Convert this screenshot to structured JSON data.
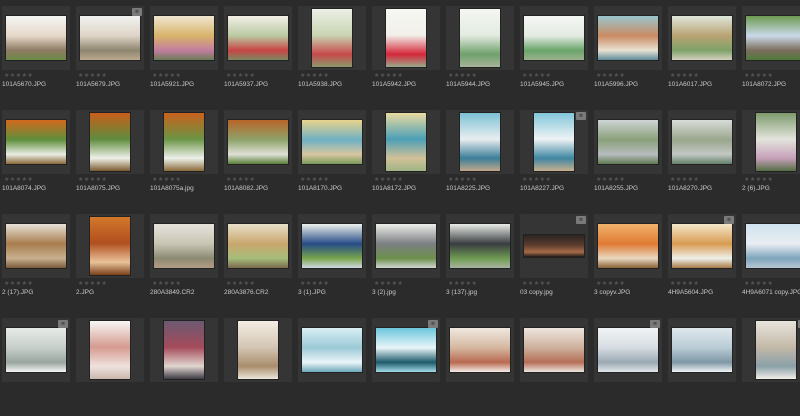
{
  "browser": {
    "star_glyphs": "★★★★★",
    "badge_label": "≡",
    "items": [
      {
        "filename": "101A5670.JPG",
        "orient": "landscape",
        "badge": false,
        "colors": [
          "#f4f6f4",
          "#e7d8c9",
          "#8d7a62",
          "#6b8a45"
        ]
      },
      {
        "filename": "101A5679.JPG",
        "orient": "landscape",
        "badge": true,
        "colors": [
          "#f2f3f1",
          "#ded4c6",
          "#8f8670",
          "#b9a98f"
        ]
      },
      {
        "filename": "101A5921.JPG",
        "orient": "landscape",
        "badge": false,
        "colors": [
          "#efe6d2",
          "#d7b46a",
          "#c47da0",
          "#6b7c57"
        ]
      },
      {
        "filename": "101A5937.JPG",
        "orient": "landscape",
        "badge": false,
        "colors": [
          "#f3efe6",
          "#b9c9a2",
          "#c84545",
          "#7b8a62"
        ]
      },
      {
        "filename": "101A5938.JPG",
        "orient": "portrait",
        "badge": false,
        "colors": [
          "#ecefe6",
          "#c9d6b4",
          "#c74a4a",
          "#8b9a6c"
        ]
      },
      {
        "filename": "101A5942.JPG",
        "orient": "portrait",
        "badge": false,
        "colors": [
          "#f6f7f3",
          "#f2f0ea",
          "#d4273a",
          "#9aa98b"
        ]
      },
      {
        "filename": "101A5944.JPG",
        "orient": "portrait",
        "badge": false,
        "colors": [
          "#f4f6f2",
          "#e4ece2",
          "#6fa06b",
          "#a8b49a"
        ]
      },
      {
        "filename": "101A5945.JPG",
        "orient": "landscape",
        "badge": false,
        "colors": [
          "#f5f7f4",
          "#e3ebe2",
          "#6aa56a",
          "#9ab18d"
        ]
      },
      {
        "filename": "101A5996.JPG",
        "orient": "landscape",
        "badge": false,
        "colors": [
          "#9ac6cf",
          "#c98b62",
          "#e9e2d3",
          "#5d8a9a"
        ]
      },
      {
        "filename": "101A6017.JPG",
        "orient": "landscape",
        "badge": false,
        "colors": [
          "#dfe7dc",
          "#b9a272",
          "#7fa269",
          "#d4d0bd"
        ]
      },
      {
        "filename": "101A8072.JPG",
        "orient": "landscape",
        "badge": false,
        "colors": [
          "#6d9a52",
          "#c9d9e9",
          "#7b6d5c",
          "#4f7b3a"
        ]
      },
      {
        "filename": "101A8074.JPG",
        "orient": "landscape",
        "badge": false,
        "colors": [
          "#d16a1e",
          "#5e8f3c",
          "#e9ede4",
          "#8a6a3a"
        ]
      },
      {
        "filename": "101A8075.JPG",
        "orient": "portrait",
        "badge": false,
        "colors": [
          "#c95e1a",
          "#5f8c3d",
          "#eef0e8",
          "#7b5a2e"
        ]
      },
      {
        "filename": "101A8075a.jpg",
        "orient": "portrait",
        "badge": false,
        "colors": [
          "#c9611c",
          "#6b9444",
          "#edf0ea",
          "#8a6a38"
        ]
      },
      {
        "filename": "101A8082.JPG",
        "orient": "landscape",
        "badge": false,
        "colors": [
          "#b86428",
          "#8ea36a",
          "#dfe0d6",
          "#5a7e3a"
        ]
      },
      {
        "filename": "101A8170.JPG",
        "orient": "landscape",
        "badge": false,
        "colors": [
          "#e8d38d",
          "#6fb0c4",
          "#d7c7a0",
          "#7a9a5a"
        ]
      },
      {
        "filename": "101A8172.JPG",
        "orient": "portrait",
        "badge": false,
        "colors": [
          "#eadba0",
          "#4c9fb6",
          "#d2c198",
          "#9fb486"
        ]
      },
      {
        "filename": "101A8225.JPG",
        "orient": "portrait",
        "badge": false,
        "colors": [
          "#7cc1d4",
          "#e9eef0",
          "#3c7d99",
          "#c2a98a"
        ]
      },
      {
        "filename": "101A8227.JPG",
        "orient": "portrait",
        "badge": true,
        "colors": [
          "#82c6da",
          "#eef3f4",
          "#3f86a2",
          "#c9b08f"
        ]
      },
      {
        "filename": "101A8255.JPG",
        "orient": "landscape",
        "badge": false,
        "colors": [
          "#ced4d5",
          "#8aa07a",
          "#b7bcbd",
          "#5f7a52"
        ]
      },
      {
        "filename": "101A8270.JPG",
        "orient": "landscape",
        "badge": false,
        "colors": [
          "#d8dcda",
          "#9aa68c",
          "#c2c7c4",
          "#62806a"
        ]
      },
      {
        "filename": "2 (6).JPG",
        "orient": "portrait",
        "badge": false,
        "colors": [
          "#7d9b6c",
          "#e3e4dc",
          "#c6a0b9",
          "#556e45"
        ]
      },
      {
        "filename": "2 (17).JPG",
        "orient": "landscape",
        "badge": false,
        "colors": [
          "#e7e1d7",
          "#a87d4e",
          "#c8b18f",
          "#7a5a3a"
        ]
      },
      {
        "filename": "2.JPG",
        "orient": "portrait",
        "badge": false,
        "colors": [
          "#d2782b",
          "#b14f1e",
          "#e9c29a",
          "#7a3f18"
        ]
      },
      {
        "filename": "280A3849.CR2",
        "orient": "landscape",
        "badge": false,
        "colors": [
          "#e4e2da",
          "#c9c5b4",
          "#8c8a73",
          "#b29c85"
        ]
      },
      {
        "filename": "280A3876.CR2",
        "orient": "landscape",
        "badge": false,
        "colors": [
          "#e8dfc9",
          "#c9a76d",
          "#a6bd7a",
          "#7a6a4e"
        ]
      },
      {
        "filename": "3 (1).JPG",
        "orient": "landscape",
        "badge": false,
        "colors": [
          "#eef1ec",
          "#254b86",
          "#78a54d",
          "#cfd9e3"
        ]
      },
      {
        "filename": "3 (2).jpg",
        "orient": "landscape",
        "badge": false,
        "colors": [
          "#eceee9",
          "#7c7f82",
          "#6c8f4c",
          "#d3d6d2"
        ]
      },
      {
        "filename": "3 (137).jpg",
        "orient": "landscape",
        "badge": false,
        "colors": [
          "#e8ece6",
          "#3a3d40",
          "#6e9a52",
          "#a9b4a0"
        ]
      },
      {
        "filename": "03 copy.jpg",
        "orient": "wide",
        "badge": true,
        "colors": [
          "#2a2422",
          "#5b3b2c",
          "#a56b4a",
          "#1d1a18"
        ]
      },
      {
        "filename": "3 copyv.JPG",
        "orient": "landscape",
        "badge": false,
        "colors": [
          "#f0b26b",
          "#df7a33",
          "#e9d8c0",
          "#8a6238"
        ]
      },
      {
        "filename": "4H9A5604.JPG",
        "orient": "landscape",
        "badge": true,
        "colors": [
          "#f4e7c9",
          "#d89b52",
          "#eef0ea",
          "#a67a48"
        ]
      },
      {
        "filename": "4H9A6071 copy.JPG",
        "orient": "landscape",
        "badge": false,
        "colors": [
          "#cfe2ee",
          "#e9eef2",
          "#7ea5bb",
          "#b7c7d2"
        ]
      },
      {
        "filename": "",
        "orient": "landscape",
        "badge": true,
        "colors": [
          "#e7eae6",
          "#c7cfca",
          "#9aa5a0",
          "#f4f5f3"
        ]
      },
      {
        "filename": "",
        "orient": "portrait",
        "badge": false,
        "colors": [
          "#f7f7f5",
          "#d59a8f",
          "#efe2de",
          "#c9b7ab"
        ]
      },
      {
        "filename": "",
        "orient": "portrait",
        "badge": false,
        "colors": [
          "#6c5a72",
          "#a54b5a",
          "#e0d6d0",
          "#3e3a44"
        ]
      },
      {
        "filename": "",
        "orient": "portrait",
        "badge": false,
        "colors": [
          "#f4ede2",
          "#d4c6b5",
          "#a88d6c",
          "#ede6da"
        ]
      },
      {
        "filename": "",
        "orient": "landscape",
        "badge": false,
        "colors": [
          "#d8eef4",
          "#9cc9d7",
          "#eaf5f8",
          "#6ea7b8"
        ]
      },
      {
        "filename": "",
        "orient": "landscape",
        "badge": true,
        "colors": [
          "#6cc6dc",
          "#e9f6f9",
          "#1d5a6a",
          "#a4dbe8"
        ]
      },
      {
        "filename": "",
        "orient": "landscape",
        "badge": false,
        "colors": [
          "#efe8e0",
          "#d4b7a0",
          "#b86a50",
          "#f2ede7"
        ]
      },
      {
        "filename": "",
        "orient": "landscape",
        "badge": false,
        "colors": [
          "#eee6de",
          "#cdb09c",
          "#b66e57",
          "#ece6df"
        ]
      },
      {
        "filename": "",
        "orient": "landscape",
        "badge": true,
        "colors": [
          "#f1f3f4",
          "#d6dde2",
          "#9aa8b2",
          "#e2e7ea"
        ]
      },
      {
        "filename": "",
        "orient": "landscape",
        "badge": false,
        "colors": [
          "#dfe8ec",
          "#b9ccd6",
          "#7f97a5",
          "#f0f3f4"
        ]
      },
      {
        "filename": "",
        "orient": "portrait",
        "badge": true,
        "colors": [
          "#e8e4dc",
          "#c3b9a8",
          "#8aa0a8",
          "#f1eee8"
        ]
      }
    ]
  }
}
